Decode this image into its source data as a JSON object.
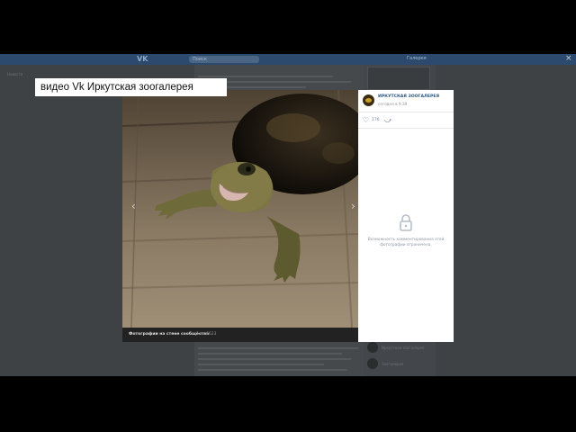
{
  "vk": {
    "logo": "VK",
    "search_placeholder": "Поиск",
    "user_menu": "Галерея",
    "close": "×"
  },
  "caption": "видео Vk Иркутская зоогалерея",
  "photo": {
    "album_label": "Фотографии на стене сообщества",
    "counter": "1 из 6623",
    "prev": "‹",
    "next": "›",
    "description": ""
  },
  "post": {
    "author": "ИРКУТСКАЯ ЗООГАЛЕРЕЯ",
    "date": "сегодня в 9:39",
    "likes": "176"
  },
  "comments_disabled": "Возможность комментирования этой фотографии ограничена.",
  "background": {
    "left_label": "Новости",
    "sidebar_items": [
      "Иркутская зоогалерея",
      "Зоогалерея"
    ]
  },
  "colors": {
    "vk_header": "#2b4a6e",
    "link": "#2a5885",
    "overlay": "#3f4244"
  }
}
